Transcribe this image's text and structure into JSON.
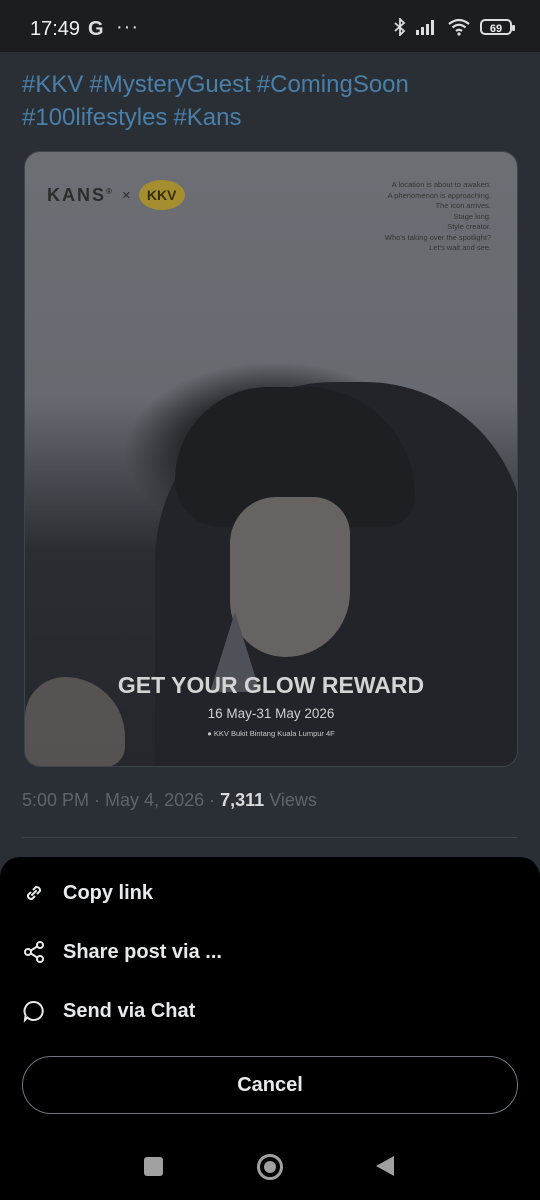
{
  "status_bar": {
    "time": "17:49",
    "g_icon": "G",
    "more_dots": "···",
    "battery": "69"
  },
  "tweet": {
    "hashtags": [
      "#KKV",
      "#MysteryGuest",
      "#ComingSoon",
      "#100lifestyles",
      "#Kans"
    ],
    "poster": {
      "brand_kans": "KANS",
      "brand_reg": "®",
      "brand_x": "×",
      "brand_kkv": "KKV",
      "tagline": [
        "A location is about to awaken.",
        "A phenomenon is approaching.",
        "The icon arrives.",
        "Stage king.",
        "Style creator.",
        "Who's taking over the spotlight?",
        "Let's wait and see."
      ],
      "headline": "GET YOUR GLOW REWARD",
      "dates": "16 May-31 May 2026",
      "venue": "KKV Bukit Bintang Kuala Lumpur 4F"
    },
    "meta": {
      "time": "5:00 PM",
      "date": "May 4, 2026",
      "views_count": "7,311",
      "views_label": "Views"
    }
  },
  "sheet": {
    "options": [
      {
        "label": "Copy link",
        "icon": "link-icon"
      },
      {
        "label": "Share post via ...",
        "icon": "share-icon"
      },
      {
        "label": "Send via Chat",
        "icon": "chat-bubble-icon"
      }
    ],
    "cancel_label": "Cancel"
  },
  "colors": {
    "hashtag": "#4a7fa9",
    "sheet_bg": "#000000",
    "dim_bg": "#2a2f35"
  }
}
